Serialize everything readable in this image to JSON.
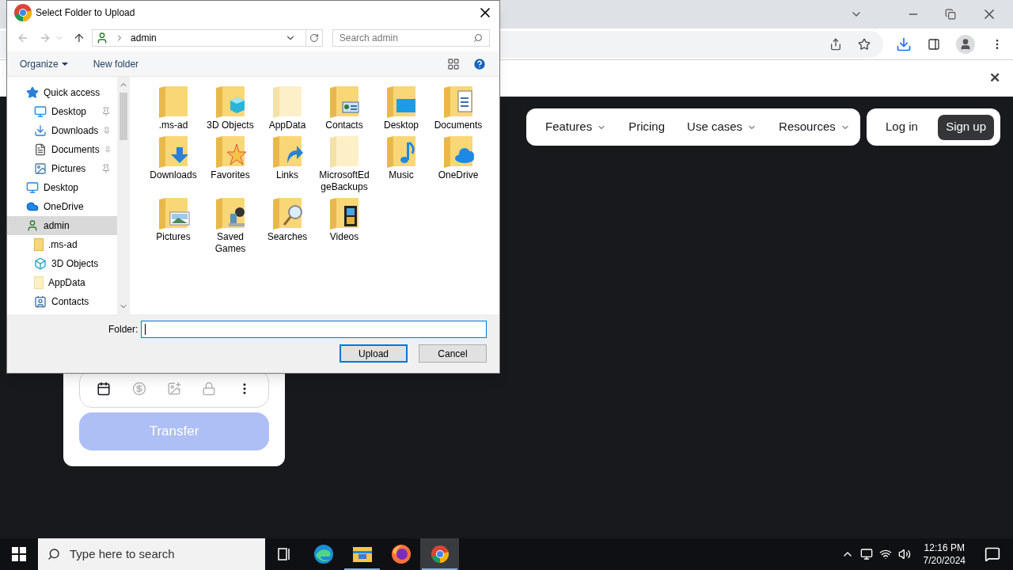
{
  "browser": {
    "infobar_close": "✕"
  },
  "nav": {
    "items": [
      {
        "label": "Features",
        "menu": true
      },
      {
        "label": "Pricing",
        "menu": false
      },
      {
        "label": "Use cases",
        "menu": true
      },
      {
        "label": "Resources",
        "menu": true
      }
    ],
    "login": "Log in",
    "signup": "Sign up"
  },
  "card": {
    "tools": [
      {
        "kind": "calendar",
        "enabled": true
      },
      {
        "kind": "dollar",
        "enabled": false
      },
      {
        "kind": "image",
        "enabled": false
      },
      {
        "kind": "lock",
        "enabled": false
      },
      {
        "kind": "more",
        "enabled": true
      }
    ],
    "transfer": {
      "label": "Transfer",
      "disabled": true
    }
  },
  "dialog": {
    "title": "Select Folder to Upload",
    "path": "admin",
    "search": {
      "placeholder": "Search admin"
    },
    "organize": "Organize",
    "new_folder": "New folder",
    "sidebar": [
      {
        "label": "Quick access",
        "kind": "star",
        "selected": false,
        "children": [
          {
            "label": "Desktop",
            "kind": "monitor",
            "pinned": true,
            "selected": false
          },
          {
            "label": "Downloads",
            "kind": "download",
            "pinned": true,
            "selected": false
          },
          {
            "label": "Documents",
            "kind": "document",
            "pinned": true,
            "selected": false
          },
          {
            "label": "Pictures",
            "kind": "picture",
            "pinned": true,
            "selected": false
          }
        ]
      },
      {
        "label": "Desktop",
        "kind": "monitor",
        "selected": false
      },
      {
        "label": "OneDrive",
        "kind": "cloud",
        "selected": false
      },
      {
        "label": "admin",
        "kind": "user",
        "selected": true,
        "children": [
          {
            "label": ".ms-ad",
            "kind": "folder",
            "selected": false
          },
          {
            "label": "3D Objects",
            "kind": "cube",
            "selected": false
          },
          {
            "label": "AppData",
            "kind": "pale",
            "selected": false
          },
          {
            "label": "Contacts",
            "kind": "contacts",
            "selected": false
          }
        ]
      }
    ],
    "folders": [
      {
        "label": ".ms-ad",
        "kind": "plain"
      },
      {
        "label": "3D Objects",
        "kind": "cube"
      },
      {
        "label": "AppData",
        "kind": "pale"
      },
      {
        "label": "Contacts",
        "kind": "contacts"
      },
      {
        "label": "Desktop",
        "kind": "monitor"
      },
      {
        "label": "Documents",
        "kind": "document"
      },
      {
        "label": "Downloads",
        "kind": "download"
      },
      {
        "label": "Favorites",
        "kind": "star"
      },
      {
        "label": "Links",
        "kind": "link"
      },
      {
        "label": "MicrosoftEdgeBackups",
        "kind": "pale"
      },
      {
        "label": "Music",
        "kind": "music"
      },
      {
        "label": "OneDrive",
        "kind": "cloud"
      },
      {
        "label": "Pictures",
        "kind": "picture"
      },
      {
        "label": "Saved Games",
        "kind": "chess"
      },
      {
        "label": "Searches",
        "kind": "search"
      },
      {
        "label": "Videos",
        "kind": "film"
      }
    ],
    "folder_label": "Folder:",
    "upload": "Upload",
    "cancel": "Cancel"
  },
  "taskbar": {
    "search": {
      "placeholder": "Type here to search"
    },
    "apps": [
      {
        "kind": "taskview",
        "selected": false,
        "running": false
      },
      {
        "kind": "edge",
        "selected": false,
        "running": false
      },
      {
        "kind": "explorer",
        "selected": false,
        "running": true
      },
      {
        "kind": "firefox",
        "selected": false,
        "running": false
      },
      {
        "kind": "chrome",
        "selected": true,
        "running": true
      }
    ],
    "time": "12:16 PM",
    "date": "7/20/2024"
  }
}
